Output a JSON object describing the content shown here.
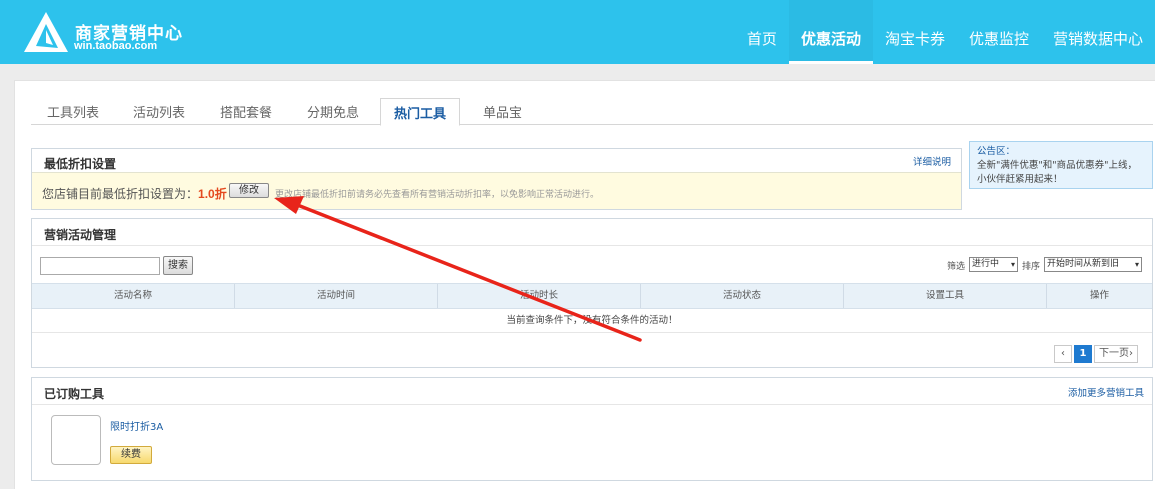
{
  "header": {
    "brand_title": "商家营销中心",
    "brand_url": "win.taobao.com",
    "nav": [
      {
        "label": "首页",
        "active": false
      },
      {
        "label": "优惠活动",
        "active": true
      },
      {
        "label": "淘宝卡券",
        "active": false
      },
      {
        "label": "优惠监控",
        "active": false
      },
      {
        "label": "营销数据中心",
        "active": false
      }
    ]
  },
  "tabs": [
    "工具列表",
    "活动列表",
    "搭配套餐",
    "分期免息",
    "热门工具",
    "单品宝"
  ],
  "active_tab": "热门工具",
  "discount": {
    "title": "最低折扣设置",
    "detail_link": "详细说明",
    "label": "您店铺目前最低折扣设置为：",
    "value": "1.0折",
    "modify_button": "修改",
    "note": "更改店铺最低折扣前请务必先查看所有营销活动折扣率，以免影响正常活动进行。"
  },
  "notice": {
    "title": "公告区：",
    "line1": "全新\"满件优惠\"和\"商品优惠券\"上线，",
    "line2": "小伙伴赶紧用起来！"
  },
  "campaigns": {
    "title": "营销活动管理",
    "search_button": "搜索",
    "search_value": "",
    "filter_label": "筛选",
    "filter_value": "进行中",
    "sort_label": "排序",
    "sort_value": "开始时间从新到旧",
    "columns": [
      "活动名称",
      "活动时间",
      "活动时长",
      "活动状态",
      "设置工具",
      "操作"
    ],
    "empty_message": "当前查询条件下，没有符合条件的活动！",
    "pager": {
      "prev": "‹",
      "current": "1",
      "next": "下一页›"
    }
  },
  "subscribed": {
    "title": "已订购工具",
    "add_more_link": "添加更多营销工具",
    "tool_name": "限时打折3A",
    "renew_button": "续费"
  },
  "colors": {
    "header_bg": "#2dc2ec",
    "annotation_arrow": "#e8241a",
    "discount_value": "#e4491e"
  }
}
